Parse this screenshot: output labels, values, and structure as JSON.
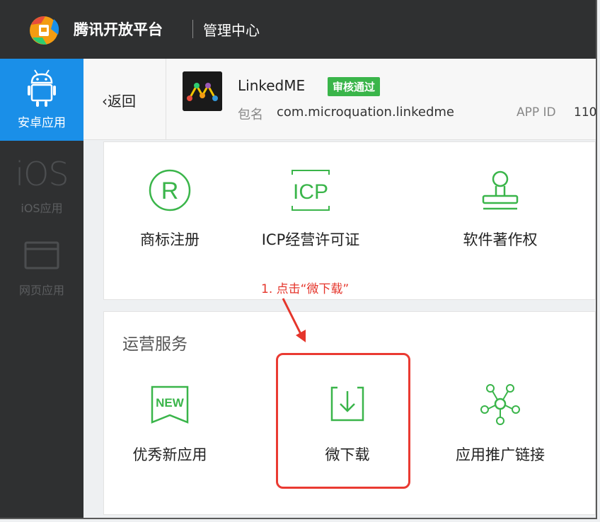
{
  "topbar": {
    "brand": "腾讯开放平台",
    "subtitle": "管理中心",
    "logo_icon": "tencent-open-logo"
  },
  "sidebar": {
    "items": [
      {
        "label": "安卓应用",
        "icon": "android-icon",
        "active": true
      },
      {
        "label": "iOS应用",
        "icon": "ios-icon",
        "icon_text": "iOS",
        "active": false
      },
      {
        "label": "网页应用",
        "icon": "browser-window-icon",
        "active": false
      }
    ]
  },
  "header": {
    "back_label": "返回",
    "app_name": "LinkedME",
    "status_badge": "审核通过",
    "package_label": "包名",
    "package_value": "com.microquation.linkedme",
    "app_id_label": "APP ID",
    "app_id_value": "110"
  },
  "services_top": [
    {
      "label": "商标注册",
      "icon": "registered-trademark-icon"
    },
    {
      "label": "ICP经营许可证",
      "icon": "icp-icon"
    },
    {
      "label": "软件著作权",
      "icon": "stamp-icon"
    }
  ],
  "operations": {
    "title": "运营服务",
    "items": [
      {
        "label": "优秀新应用",
        "icon": "new-badge-icon",
        "icon_text": "NEW"
      },
      {
        "label": "微下载",
        "icon": "download-icon"
      },
      {
        "label": "应用推广链接",
        "icon": "network-nodes-icon"
      }
    ]
  },
  "annotation": {
    "text": "1. 点击“微下载”",
    "color": "#e5352b"
  },
  "colors": {
    "accent_green": "#3ab54a",
    "sidebar_active": "#1a8fe8",
    "dark_bar": "#2f3031"
  }
}
